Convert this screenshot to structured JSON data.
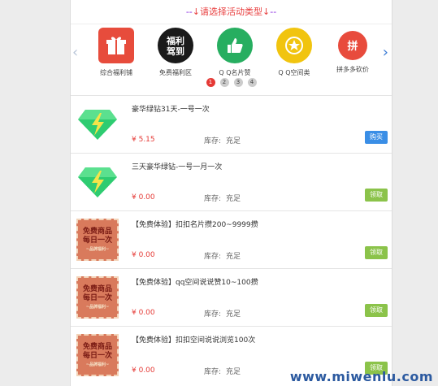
{
  "header": {
    "prefix": "--",
    "title": "↓请选择活动类型↓",
    "suffix": "--"
  },
  "carousel": {
    "left_arrow": "‹",
    "right_arrow": "›",
    "categories": [
      {
        "label": "综合福利铺",
        "icon": "gift-icon",
        "color": "#e74c3c"
      },
      {
        "label": "免费福利区",
        "icon_text": "福利\n驾到",
        "color": "#1a1a1a"
      },
      {
        "label": "Q Q名片赞",
        "icon": "thumbs-up-icon",
        "color": "#27ae60"
      },
      {
        "label": "Q Q空间类",
        "icon": "star-icon",
        "color": "#f1c40f"
      },
      {
        "label": "拼多多砍价",
        "icon_text": "拼",
        "color": "#e84b3c"
      }
    ],
    "pages": [
      "1",
      "2",
      "3",
      "4"
    ],
    "active_page": "1"
  },
  "products": [
    {
      "name": "豪华绿钻31天-一号一次",
      "price": "¥ 5.15",
      "stock_label": "库存:",
      "stock_value": "充足",
      "button": "购买",
      "thumb": "green-diamond-icon"
    },
    {
      "name": "三天豪华绿钻-一号一月一次",
      "price": "¥ 0.00",
      "stock_label": "库存:",
      "stock_value": "充足",
      "button": "领取",
      "thumb": "green-diamond-icon"
    },
    {
      "name": "【免费体验】扣扣名片攒200~9999攒",
      "price": "¥ 0.00",
      "stock_label": "库存:",
      "stock_value": "充足",
      "button": "领取",
      "thumb": "free-stamp"
    },
    {
      "name": "【免费体验】qq空间说说赞10~100攒",
      "price": "¥ 0.00",
      "stock_label": "库存:",
      "stock_value": "充足",
      "button": "领取",
      "thumb": "free-stamp"
    },
    {
      "name": "【免费体验】扣扣空间说说浏览100次",
      "price": "¥ 0.00",
      "stock_label": "库存:",
      "stock_value": "充足",
      "button": "领取",
      "thumb": "free-stamp"
    }
  ],
  "stamp_text": {
    "line1": "免费商品",
    "line2": "每日一次",
    "line3": "~品牌福利~"
  },
  "watermark": "www.miwenlu.com"
}
